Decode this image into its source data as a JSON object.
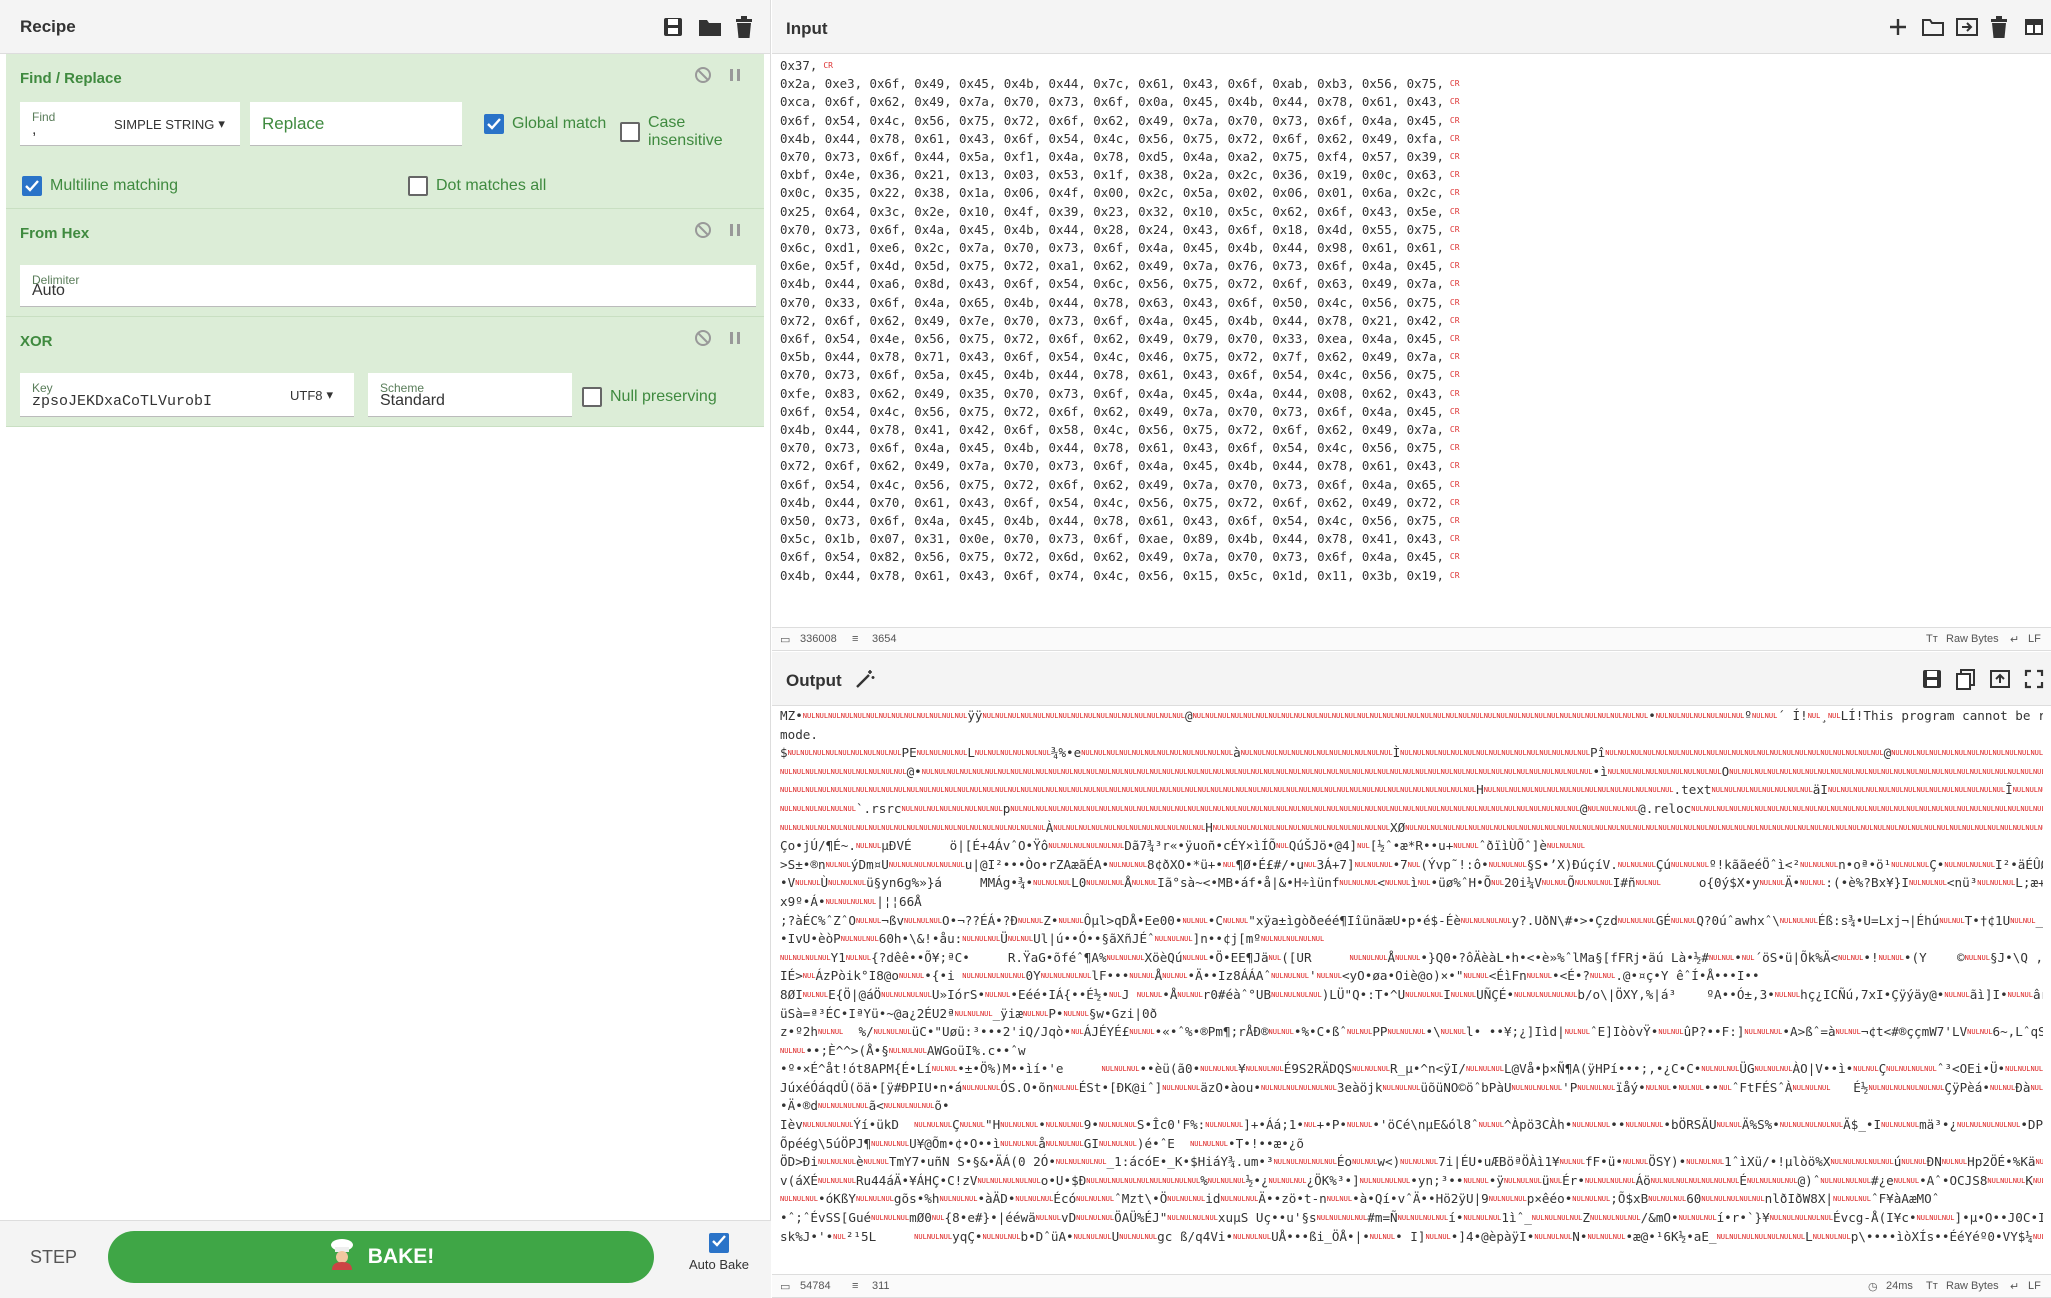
{
  "recipe": {
    "title": "Recipe",
    "operations": [
      {
        "name": "Find / Replace"
      },
      {
        "name": "From Hex"
      },
      {
        "name": "XOR"
      }
    ],
    "find_replace": {
      "find_label": "Find",
      "find_value": ",",
      "find_type": "SIMPLE STRING",
      "replace_placeholder": "Replace",
      "global_match": "Global match",
      "case_insensitive": "Case insensitive",
      "multiline": "Multiline matching",
      "dot_matches": "Dot matches all"
    },
    "from_hex": {
      "delimiter_label": "Delimiter",
      "delimiter_value": "Auto"
    },
    "xor": {
      "key_label": "Key",
      "key_value": "zpsoJEKDxaCoTLVurobI",
      "key_encoding": "UTF8",
      "scheme_label": "Scheme",
      "scheme_value": "Standard",
      "null_preserving": "Null preserving"
    },
    "step": "STEP",
    "bake": "BAKE!",
    "auto_bake": "Auto Bake"
  },
  "input": {
    "title": "Input",
    "lines": [
      "0x37,",
      "0x2a, 0xe3, 0x6f, 0x49, 0x45, 0x4b, 0x44, 0x7c, 0x61, 0x43, 0x6f, 0xab, 0xb3, 0x56, 0x75,",
      "0xca, 0x6f, 0x62, 0x49, 0x7a, 0x70, 0x73, 0x6f, 0x0a, 0x45, 0x4b, 0x44, 0x78, 0x61, 0x43,",
      "0x6f, 0x54, 0x4c, 0x56, 0x75, 0x72, 0x6f, 0x62, 0x49, 0x7a, 0x70, 0x73, 0x6f, 0x4a, 0x45,",
      "0x4b, 0x44, 0x78, 0x61, 0x43, 0x6f, 0x54, 0x4c, 0x56, 0x75, 0x72, 0x6f, 0x62, 0x49, 0xfa,",
      "0x70, 0x73, 0x6f, 0x44, 0x5a, 0xf1, 0x4a, 0x78, 0xd5, 0x4a, 0xa2, 0x75, 0xf4, 0x57, 0x39,",
      "0xbf, 0x4e, 0x36, 0x21, 0x13, 0x03, 0x53, 0x1f, 0x38, 0x2a, 0x2c, 0x36, 0x19, 0x0c, 0x63,",
      "0x0c, 0x35, 0x22, 0x38, 0x1a, 0x06, 0x4f, 0x00, 0x2c, 0x5a, 0x02, 0x06, 0x01, 0x6a, 0x2c,",
      "0x25, 0x64, 0x3c, 0x2e, 0x10, 0x4f, 0x39, 0x23, 0x32, 0x10, 0x5c, 0x62, 0x6f, 0x43, 0x5e,",
      "0x70, 0x73, 0x6f, 0x4a, 0x45, 0x4b, 0x44, 0x28, 0x24, 0x43, 0x6f, 0x18, 0x4d, 0x55, 0x75,",
      "0x6c, 0xd1, 0xe6, 0x2c, 0x7a, 0x70, 0x73, 0x6f, 0x4a, 0x45, 0x4b, 0x44, 0x98, 0x61, 0x61,",
      "0x6e, 0x5f, 0x4d, 0x5d, 0x75, 0x72, 0xa1, 0x62, 0x49, 0x7a, 0x76, 0x73, 0x6f, 0x4a, 0x45,",
      "0x4b, 0x44, 0xa6, 0x8d, 0x43, 0x6f, 0x54, 0x6c, 0x56, 0x75, 0x72, 0x6f, 0x63, 0x49, 0x7a,",
      "0x70, 0x33, 0x6f, 0x4a, 0x65, 0x4b, 0x44, 0x78, 0x63, 0x43, 0x6f, 0x50, 0x4c, 0x56, 0x75,",
      "0x72, 0x6f, 0x62, 0x49, 0x7e, 0x70, 0x73, 0x6f, 0x4a, 0x45, 0x4b, 0x44, 0x78, 0x21, 0x42,",
      "0x6f, 0x54, 0x4e, 0x56, 0x75, 0x72, 0x6f, 0x62, 0x49, 0x79, 0x70, 0x33, 0xea, 0x4a, 0x45,",
      "0x5b, 0x44, 0x78, 0x71, 0x43, 0x6f, 0x54, 0x4c, 0x46, 0x75, 0x72, 0x7f, 0x62, 0x49, 0x7a,",
      "0x70, 0x73, 0x6f, 0x5a, 0x45, 0x4b, 0x44, 0x78, 0x61, 0x43, 0x6f, 0x54, 0x4c, 0x56, 0x75,",
      "0xfe, 0x83, 0x62, 0x49, 0x35, 0x70, 0x73, 0x6f, 0x4a, 0x45, 0x4a, 0x44, 0x08, 0x62, 0x43,",
      "0x6f, 0x54, 0x4c, 0x56, 0x75, 0x72, 0x6f, 0x62, 0x49, 0x7a, 0x70, 0x73, 0x6f, 0x4a, 0x45,",
      "0x4b, 0x44, 0x78, 0x41, 0x42, 0x6f, 0x58, 0x4c, 0x56, 0x75, 0x72, 0x6f, 0x62, 0x49, 0x7a,",
      "0x70, 0x73, 0x6f, 0x4a, 0x45, 0x4b, 0x44, 0x78, 0x61, 0x43, 0x6f, 0x54, 0x4c, 0x56, 0x75,",
      "0x72, 0x6f, 0x62, 0x49, 0x7a, 0x70, 0x73, 0x6f, 0x4a, 0x45, 0x4b, 0x44, 0x78, 0x61, 0x43,",
      "0x6f, 0x54, 0x4c, 0x56, 0x75, 0x72, 0x6f, 0x62, 0x49, 0x7a, 0x70, 0x73, 0x6f, 0x4a, 0x65,",
      "0x4b, 0x44, 0x70, 0x61, 0x43, 0x6f, 0x54, 0x4c, 0x56, 0x75, 0x72, 0x6f, 0x62, 0x49, 0x72,",
      "0x50, 0x73, 0x6f, 0x4a, 0x45, 0x4b, 0x44, 0x78, 0x61, 0x43, 0x6f, 0x54, 0x4c, 0x56, 0x75,",
      "0x5c, 0x1b, 0x07, 0x31, 0x0e, 0x70, 0x73, 0x6f, 0xae, 0x89, 0x4b, 0x44, 0x78, 0x41, 0x43,",
      "0x6f, 0x54, 0x82, 0x56, 0x75, 0x72, 0x6d, 0x62, 0x49, 0x7a, 0x70, 0x73, 0x6f, 0x4a, 0x45,",
      "0x4b, 0x44, 0x78, 0x61, 0x43, 0x6f, 0x74, 0x4c, 0x56, 0x15, 0x5c, 0x1d, 0x11, 0x3b, 0x19,"
    ],
    "status_chars": "336008",
    "status_lines": "3654",
    "raw_bytes": "Raw Bytes",
    "eol": "LF"
  },
  "output": {
    "title": "Output",
    "lines": [
      "MZ•·············ÿÿ················@····································•·······º··´ Í!·¸·LÍ!This program cannot be run in DOS",
      "mode.",
      "$·········PE····L······¾%•e············à············Ì···············Pî······················@·································@·········",
      "··········@•·····················································•ì·········O·························································································",
      "·······················································H···············.text········äI··············Î····························",
      "······`.rsrc········p·············································@····@.reloc··················································",
      "·····················À············H··············XØ··································································································Ñ}",
      "Ço•jÚ/¶É~.··µÐVÉ     ö|[É+4ÁvˆO•Ÿô······Dã7¾³r«•ÿuoñ•cÉY×ìÍÕ·QúŠJö•@4]·[½ˆ•æ*R••u+··ˆðïìÙÕˆ]è···",
      ">S±•®n··ýDm¤U······u|@I²•••Òo•rZAæãÉA•···8¢ðXO•*ü+•·¶Ø•­É£#/•u·3Á+7]···•7·(Ývp˜!:ô•···§S•’X)ÐúçíV.···Çú···º!kããeéÖˆì<²···n•oª•ö¹···Ç•····I²•äÉÛØ,³···BI•É|MˆC••··•IÄ•",
      "•V··Ù···ü§yn6g%»}á     MMÁg•¾•···L0···Å··Iã°sà~<•MB•áf•å|&•H÷ìünf···<··ì·•üø%ˆH•Õ·20i¼V··Õ···I#ñ··     o{0ý$X•y··Ä•··:(•è%?Bx¥}I···<nü³···L;æ+,Õ••Ä··n•··RéÉMüý•···hké•cí•I&•··",
      "x9º•Á•····|¦¦66Å",
      ";?àÉC%ˆZˆO··¬ßv···O•¬??ÉÁ•?Ð··Z•··Ôµl>qDÅ•Ee00•··•C··\"xÿa±ìgòðeéé¶IîünäæU•p•é$-Éè····y?.UðN\\#•>•Çzd···GÉ··Q?0úˆawhxˆ\\···Éß:s¾•U=Lxj¬|Éhú··T•†¢1U··_x%\\Ð••É¹P õIK[•;•7•",
      "•IvU•èòP···60h•\\&!•åu:···Ü··Ul|ú••Ó••§ãXñJÉˆ···]n••¢j[mº·····",
      "····Y1··{?dêê••Õ¥;ªC•     R.ŸaG•õféˆ¶A%···XöèQú··•Ö•EE¶Jä·([UR     ···Å··•}Q0•?ôÄèàL•h•<•è»%ˆlMa§[fFRj•äú Là•½#··•·´öS•ü|Õk%Ä<··•!··•(Y    ©··§J•\\Q ,~ˆ§&q~Å•···a4",
      "IÉ>·ÁzPòik°I8@o··•{•i ·····0Y····lF•••··Å··•Ä••Iz8ÁÁAˆ···'··<yO•øa•Oiè@o)×•\"··<ÉìFn··•<É•?··.@•¤ç•Y êˆÍ•Å•••I••",
      "8ØI··E{Ö|@áÖ····U»IórS•··•Eéé•IÁ{••É½•·J ··•Å··r0#éàˆ°UB····)LÜ\"Q•:T•^U···I··UÑÇÉ•·····b/o\\|ÖXY,%|á³    ºA••Ó±,3•··hç¿ICÑú,7xI•Çÿýäy@•··ãì]I•··ârÐN···ÖA8Å¥Y··A•··ÁÅ··•B•",
      "üSà=ª³ÉC•IªYü•~@a¿2ÉU2ª···_ÿiæ··P•··§w•Gzi|0ð",
      "z•º2h··  %/···üC•\"Uøü:³•••2'iQ/Jqò•·ÁJÉYÉ£··•«•ˆ%•®Pm¶;rÅÐ®··•%•C•ßˆ··PP···•\\··l• ••¥;¿]Iìd|··ˆE]IòòvŸ•··ûP?••F:]···•A>ßˆ=à··¬¢t<#®ççmW7'LV··6~,LˆqSR•···3··§CF··· ··K··Mæ•",
      "··••;È^^>(Å•§···AWGoüI%.c••ˆw",
      "•º•×É^åt!ót8APM{É•Lí··•±•Ö%)M••ìí•'e     ···••èü(ã0•···¥···É9S2RÄDQS···R_µ•^n<ÿI/···L@Vå•þ×Ñ¶A(ÿHPí•••;,•¿C•C•···ÜG···ÀO|V••ì•··Ç····ˆ³<OEi•Ü•···ú21······À•§i=•",
      "JúxéÓáqdÛ(öä•[ÿ#ÐPIU•n•á···ÓS.O•õn··ÉSt•[ÐK@iˆ]···äzO•àou•······3eàöjk···üõüNO©öˆbPàU····'P···ïåý•··•··••·ˆFtFÉSˆÀ···   É½······ÇÿPèá•··Ðà·}•,x:···TˆYÁìCY=³•••",
      "•Ä•®d····ã<····õ•",
      "Ièv····Ýí•ükD  ···Ç··\"H···•···9•···S•Îc0'F%:···]+•Áá;1•·+•P•··•'öCé\\nµE&ól8ˆ··^Àpö3CÀh•···••···•bÖRSÄU··Ä%S%•·····Ä$_•I···mä³•¿·····•DP··&0V•ÖÕ$AWh•••R^••³····Nõh",
      "Õpéég\\5úÖPJ¶···U¥@Õm•¢•O••ì···å···GI···)é•ˆE  ···•T•!••æ•¿õ",
      "ÖD>Ði···è··TmY7•uñN S•§&•ÄÁ(0 2Ó•····_1:ácóE•_K•$HiáY¾.um•³·····Éo··w<)···7i|ÉU•uÆBöªÖÀì1¥··fF•ü•··ÖSY)•···1ˆìXü/•!µlòö%X·····ú··ÐN··Hp2ÖÉ•%Kä···.ø)ÄC···?[T•···%··· ä··",
      "v(áXÉ···Ru44áÄ•¥ÁHÇ•C!zV·····o•U•$Ð·········%···½•¿···¿ÖK%³•]····•yn;³••··•ÿ···ü·Ér•····Áö·······É····@)ˆ····#¿e··•Aˆ•OCJS8···K···UˆCL•····•:······•sQ_Ùà···•···  #nm¥···\\",
      "···•óKßY···gõs•%h···•àÄD•···Écó···ˆMzt\\•Ö···id···Ä••zö•t-n··•à•Qí•vˆÄ••Hö2ÿU|9···p×êéo•···;Õ$xB···60·····nlðIðW8X|···ˆF¥àAæMOˆ",
      "•ˆ;ˆÉvSS[Gué···mØ0·{8•e#}•|ééwä··vD···ÖAÜ%ÉJ\"····xuµS Uç••u'§s····#m=Ñ····í•···1ìˆ_····Z····/&mO•···í•r•`}¥·····Évcg-Å(I¥c•···]•µ•O••J0C•In3···hi•···Mö···•fAödí···tÖ···1`ÈI'Ñä3u···",
      "sk%J•'•·²¹5L     ···yqÇ•···b•DˆüA•···U···gc ß/q4Vi•···UÅ•••ßi_ÖÅ•|•··• I]··•]4•@èpàÿI•···N•···•æ@•¹6K½•aE_·······L···p\\••••ìòXÍs••ÉéYéº0•VY$¼····éI··················?•···•,Æ/"
    ],
    "status_chars": "54784",
    "status_lines": "311",
    "time": "24ms",
    "raw_bytes": "Raw Bytes",
    "eol": "LF"
  },
  "colors": {
    "accent": "#3fa646",
    "op_bg": "#dcedd7",
    "op_text": "#3f8a3f",
    "check": "#2a73c8",
    "control_char": "#d22222"
  }
}
